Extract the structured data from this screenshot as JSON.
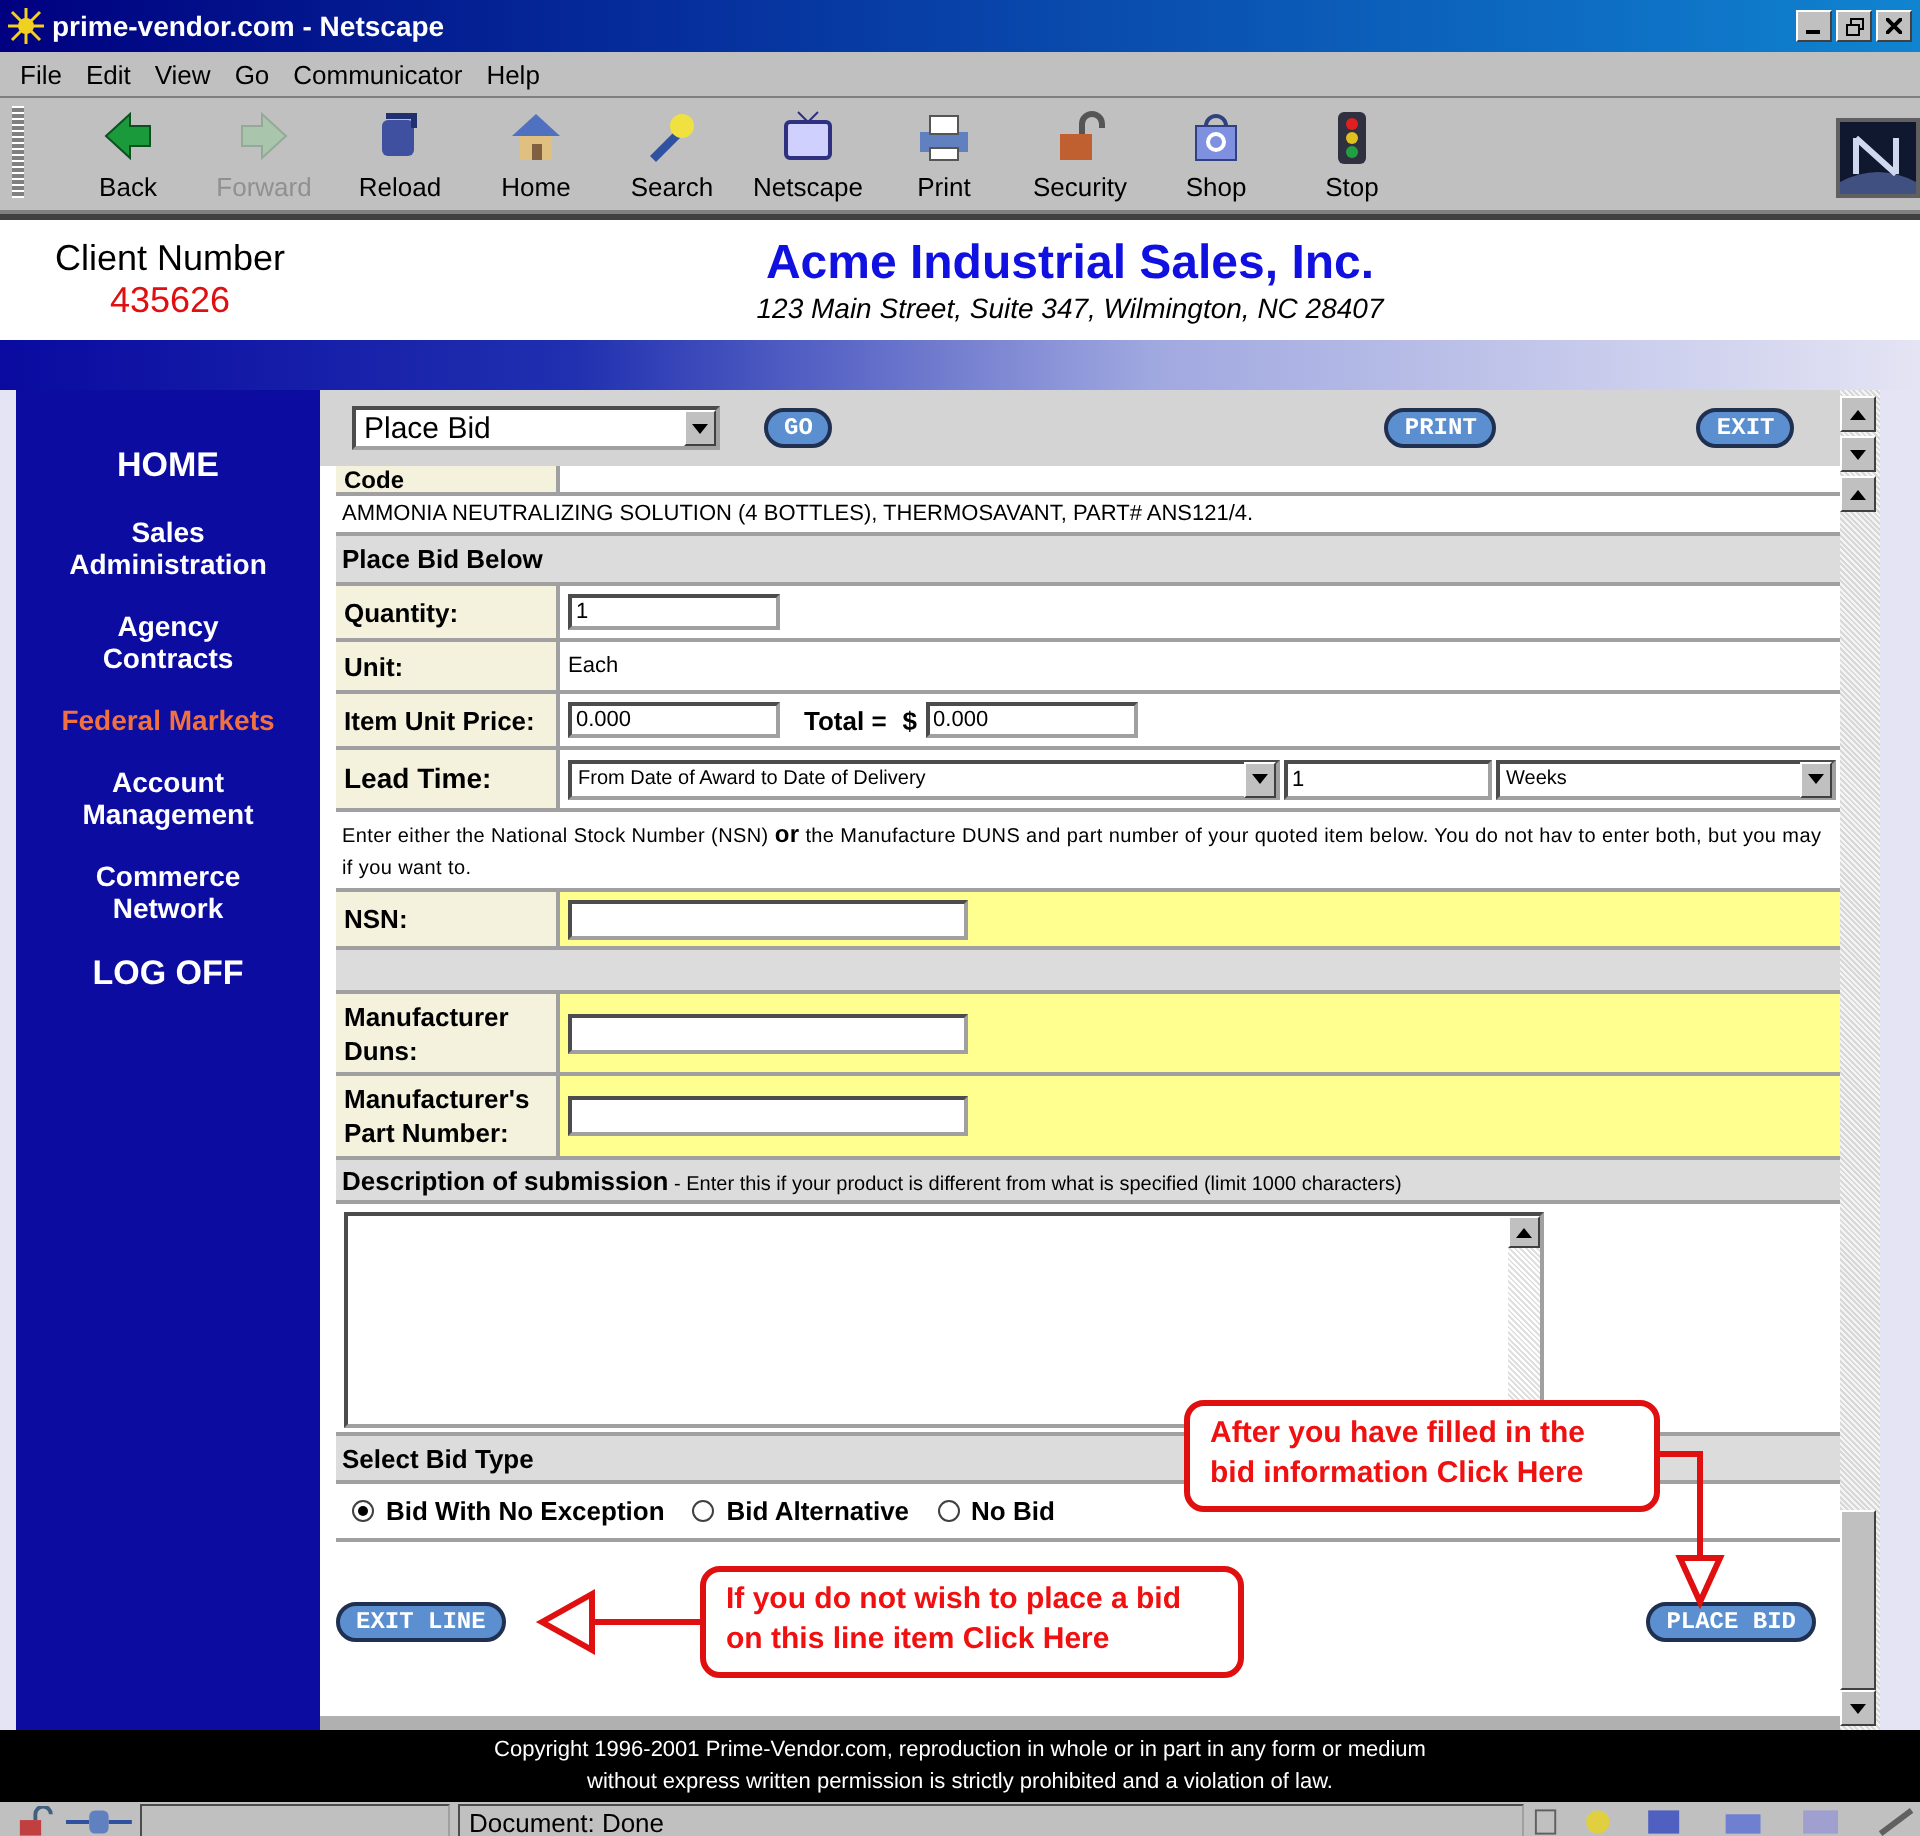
{
  "window": {
    "title": "prime-vendor.com - Netscape"
  },
  "menu": [
    "File",
    "Edit",
    "View",
    "Go",
    "Communicator",
    "Help"
  ],
  "toolbar": [
    {
      "label": "Back",
      "kind": "back",
      "disabled": false
    },
    {
      "label": "Forward",
      "kind": "forward",
      "disabled": true
    },
    {
      "label": "Reload",
      "kind": "reload",
      "disabled": false
    },
    {
      "label": "Home",
      "kind": "home",
      "disabled": false
    },
    {
      "label": "Search",
      "kind": "search",
      "disabled": false
    },
    {
      "label": "Netscape",
      "kind": "tv",
      "disabled": false
    },
    {
      "label": "Print",
      "kind": "print",
      "disabled": false
    },
    {
      "label": "Security",
      "kind": "lock",
      "disabled": false
    },
    {
      "label": "Shop",
      "kind": "shop",
      "disabled": false
    },
    {
      "label": "Stop",
      "kind": "stop",
      "disabled": false
    }
  ],
  "header": {
    "client_label": "Client Number",
    "client_number": "435626",
    "company": "Acme Industrial Sales, Inc.",
    "address": "123 Main Street, Suite 347, Wilmington, NC 28407"
  },
  "nav": [
    {
      "label": "HOME",
      "selected": false
    },
    {
      "label": "Sales Administration",
      "selected": false
    },
    {
      "label": "Agency Contracts",
      "selected": false
    },
    {
      "label": "Federal Markets",
      "selected": true
    },
    {
      "label": "Account Management",
      "selected": false
    },
    {
      "label": "Commerce Network",
      "selected": false
    },
    {
      "label": "LOG OFF",
      "selected": false
    }
  ],
  "action_bar": {
    "dropdown": "Place Bid",
    "go": "GO",
    "print": "PRINT",
    "exit": "EXIT"
  },
  "form": {
    "code_label": "Code",
    "item_description": "AMMONIA NEUTRALIZING SOLUTION (4 BOTTLES), THERMOSAVANT, PART# ANS121/4.",
    "section_title": "Place Bid Below",
    "quantity": {
      "label": "Quantity:",
      "value": "1"
    },
    "unit": {
      "label": "Unit:",
      "value": "Each"
    },
    "unit_price": {
      "label": "Item Unit Price:",
      "value": "0.000"
    },
    "total": {
      "label": "Total =",
      "currency": "$",
      "value": "0.000"
    },
    "lead_time": {
      "label": "Lead Time:",
      "basis": "From Date of Award to Date of Delivery",
      "amount": "1",
      "period": "Weeks"
    },
    "instructions": "Enter either the National Stock Number (NSN) **or** the Manufacture DUNS and part number of your quoted item below. You do not hav to enter both, but you may if you want to.",
    "nsn": {
      "label": "NSN:"
    },
    "duns": {
      "label": "Manufacturer Duns:"
    },
    "part_number": {
      "label": "Manufacturer's Part Number:"
    },
    "description": {
      "label": "Description of submission",
      "hint": "- Enter this if your product is different from what is specified (limit 1000 characters)"
    },
    "bid_type": {
      "title": "Select Bid Type",
      "options": [
        {
          "label": "Bid With No Exception",
          "selected": true
        },
        {
          "label": "Bid Alternative",
          "selected": false
        },
        {
          "label": "No Bid",
          "selected": false
        }
      ]
    },
    "exit_button": "EXIT LINE",
    "place_button": "PLACE BID"
  },
  "callouts": [
    {
      "kind": "down",
      "text": "After you have filled in the bid information Click Here"
    },
    {
      "kind": "left",
      "text": "If you do not wish to place a bid on this line item Click Here"
    }
  ],
  "footer": "Copyright 1996-2001 Prime-Vendor.com, reproduction in whole or in part in any form or medium without express written permission is strictly prohibited and a violation of law.",
  "status": "Document: Done"
}
